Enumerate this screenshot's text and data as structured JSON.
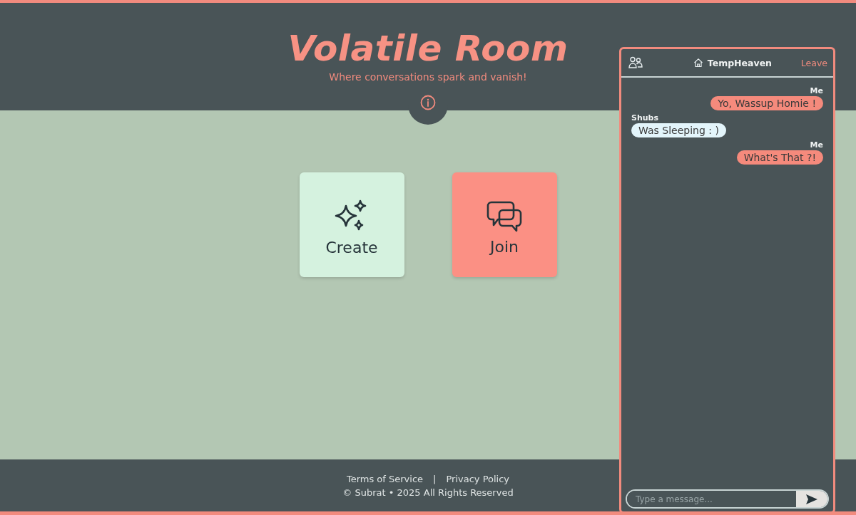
{
  "header": {
    "title": "Volatile Room",
    "tagline": "Where conversations spark and vanish!"
  },
  "actions": [
    {
      "label": "Create",
      "kind": "create"
    },
    {
      "label": "Join",
      "kind": "join"
    }
  ],
  "footer": {
    "links": [
      "Terms of Service",
      "Privacy Policy"
    ],
    "separator": "|",
    "copyright": "© Subrat • 2025 All Rights Reserved"
  },
  "chat": {
    "room": "TempHeaven",
    "leave": "Leave",
    "messages": [
      {
        "sender": "Me",
        "text": "Yo, Wassup Homie !",
        "kind": "self"
      },
      {
        "sender": "Shubs",
        "text": "Was Sleeping : )",
        "kind": "other"
      },
      {
        "sender": "Me",
        "text": "What's That ?!",
        "kind": "self"
      }
    ],
    "input": {
      "placeholder": "Type a message..."
    }
  }
}
